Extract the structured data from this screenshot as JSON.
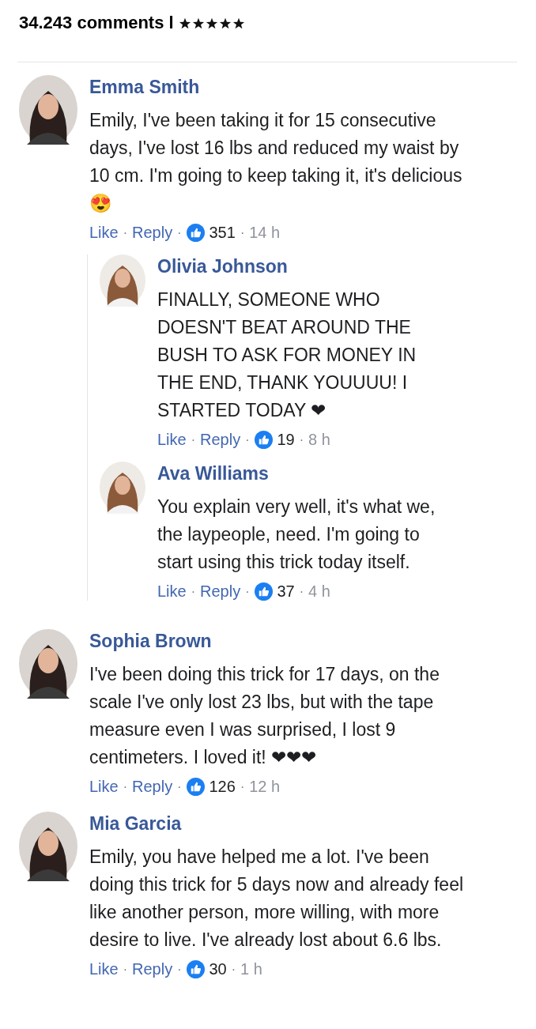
{
  "header": {
    "count": "34.243 comments l",
    "stars": 5
  },
  "comments": [
    {
      "name": "Emma Smith",
      "avatar": {
        "kind": "picture"
      },
      "text": "Emily, I've been taking it for 15 consecutive days, I've lost 16 lbs and reduced my waist by 10 cm. I'm going to keep taking it, it's delicious 😍",
      "like": "Like",
      "reply": "Reply",
      "likes": "351",
      "time": "14 h",
      "seps": [
        "·",
        "·",
        "·"
      ],
      "replies": [
        {
          "name": "Olivia Johnson",
          "avatar": {
            "kind": "picture"
          },
          "text": "FINALLY, SOMEONE WHO DOESN'T BEAT AROUND THE BUSH TO ASK FOR MONEY IN THE END, THANK YOUUUU! I STARTED TODAY ❤",
          "like": "Like",
          "reply": "Reply",
          "likes": "19",
          "time": "8 h",
          "seps": [
            "·",
            "·",
            "·"
          ]
        },
        {
          "name": "Ava Williams",
          "avatar": {
            "kind": "picture"
          },
          "text": "You explain very well, it's what we, the laypeople, need. I'm going to start using this trick today itself.",
          "like": "Like",
          "reply": "Reply",
          "likes": "37",
          "time": "4 h",
          "seps": [
            "·",
            "·",
            "·"
          ]
        }
      ]
    },
    {
      "name": "Sophia Brown",
      "avatar": {
        "kind": "picture"
      },
      "text": "I've been doing this trick for 17 days, on the scale I've only lost 23 lbs, but with the tape measure even I was surprised, I lost 9 centimeters. I loved it! ❤❤❤",
      "like": "Like",
      "reply": "Reply",
      "likes": "126",
      "time": "12 h",
      "seps": [
        "·",
        "·",
        "·"
      ]
    },
    {
      "name": "Mia Garcia",
      "avatar": {
        "kind": "picture"
      },
      "text": "Emily, you have helped me a lot. I've been doing this trick for 5 days now and already feel like another person, more willing, with more desire to live. I've already lost about 6.6 lbs.",
      "like": "Like",
      "reply": "Reply",
      "likes": "30",
      "time": "1 h",
      "seps": [
        "·",
        "·",
        "·"
      ]
    }
  ]
}
